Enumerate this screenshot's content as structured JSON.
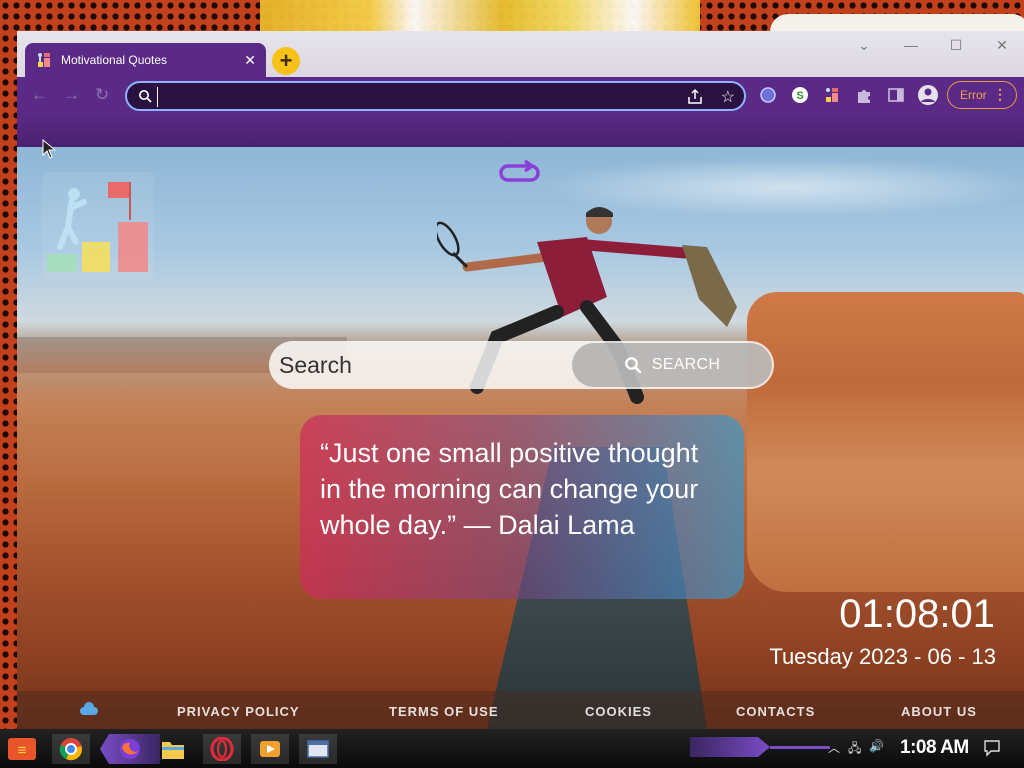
{
  "browser": {
    "tab_title": "Motivational Quotes",
    "address_value": "",
    "error_label": "Error"
  },
  "page": {
    "search": {
      "placeholder": "Search",
      "button_label": "SEARCH"
    },
    "quote": "“Just one small positive thought in the morning can change your whole day.” — Dalai Lama",
    "clock": {
      "time": "01:08:01",
      "date": "Tuesday 2023 - 06 - 13"
    },
    "footer": {
      "links": [
        "PRIVACY POLICY",
        "TERMS OF USE",
        "COOKIES",
        "CONTACTS",
        "ABOUT US"
      ]
    }
  },
  "taskbar": {
    "clock": "1:08 AM"
  },
  "colors": {
    "browser_theme": "#5b2a86",
    "new_tab_button": "#f6c217",
    "omnibox_border": "#8fb3ff",
    "error_accent": "#e79b45",
    "quote_gradient_start": "#ce2c5c",
    "quote_gradient_end": "#3c96c8"
  },
  "icons": {
    "tab_favicon": "motivation-logo-icon",
    "new_tab": "plus-icon",
    "refresh_wallpaper": "refresh-icon",
    "search": "search-icon",
    "extensions": [
      "globe-extension-icon",
      "s-extension-icon",
      "motivation-extension-icon",
      "puzzle-icon",
      "sidepanel-icon",
      "profile-icon"
    ],
    "taskbar": [
      "start-icon",
      "chrome-icon",
      "firefox-icon",
      "file-explorer-icon",
      "opera-icon",
      "media-player-icon",
      "window-app-icon"
    ]
  }
}
